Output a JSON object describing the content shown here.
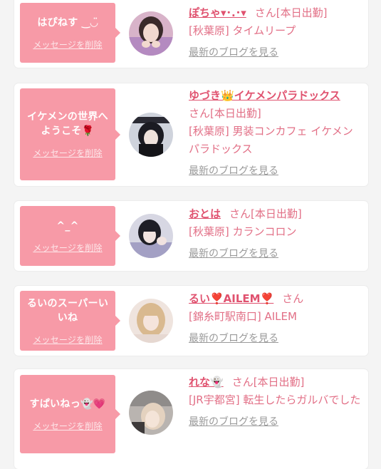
{
  "items": [
    {
      "message": "はぴねす ‿◡̈",
      "delete_label": "メッセージを削除",
      "name": "ぽちゃ▾･.･▾",
      "suffix": "さん",
      "status": "[本日出勤]",
      "shop": "[秋葉原] タイムリープ",
      "blog_label": "最新のブログを見る",
      "avatar_colors": [
        "#d8b3c9",
        "#3a2a2a",
        "#f2d9cf"
      ]
    },
    {
      "message": "イケメンの世界へようこそ🌹",
      "delete_label": "メッセージを削除",
      "name": "ゆづき👑イケメンパラドックス",
      "suffix": "さん",
      "status": "[本日出勤]",
      "shop": "[秋葉原] 男装コンカフェ イケメンパラドックス",
      "blog_label": "最新のブログを見る",
      "avatar_colors": [
        "#cfd3dc",
        "#1b1b22",
        "#efe2dc"
      ]
    },
    {
      "message": "^_^",
      "delete_label": "メッセージを削除",
      "name": "おとは",
      "suffix": "さん",
      "status": "[本日出勤]",
      "shop": "[秋葉原] カランコロン",
      "blog_label": "最新のブログを見る",
      "avatar_colors": [
        "#d7d7e3",
        "#1e1e26",
        "#f1e3e0"
      ]
    },
    {
      "message": "るいのスーパーいいね",
      "delete_label": "メッセージを削除",
      "name": "るい❣️AILEM❣️",
      "suffix": "さん",
      "status": "",
      "shop": "[錦糸町駅南口] AILEM",
      "blog_label": "最新のブログを見る",
      "avatar_colors": [
        "#efe4de",
        "#d9b98f",
        "#f5e4dc"
      ]
    },
    {
      "message": "すぱいねっ👻💗",
      "delete_label": "メッセージを削除",
      "name": "れな👻",
      "suffix": "さん",
      "status": "[本日出勤]",
      "shop": "[JR宇都宮] 転生したらガルバでした",
      "blog_label": "最新のブログを見る",
      "avatar_colors": [
        "#b9b4b0",
        "#e4d2bf",
        "#3d3a3a"
      ]
    }
  ]
}
